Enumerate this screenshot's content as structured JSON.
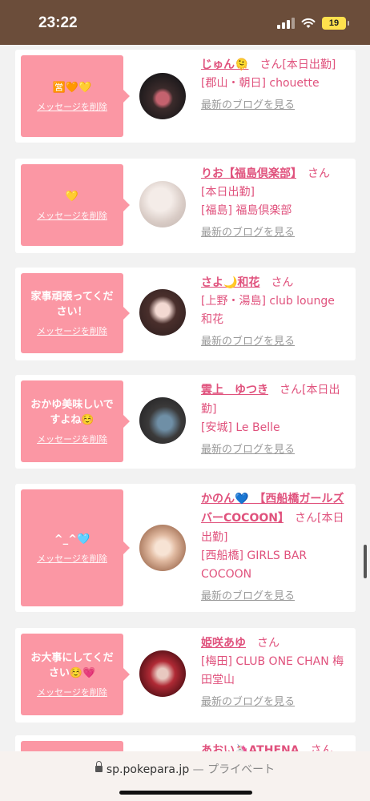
{
  "status_bar": {
    "time": "23:22",
    "battery": "19"
  },
  "delete_label": "メッセージを削除",
  "blog_label": "最新のブログを見る",
  "cards": [
    {
      "message": "🈺🧡💛",
      "name": "じゅん🫠",
      "suffix": "さん[本日出勤]",
      "lines": [
        "[郡山・朝日] chouette"
      ]
    },
    {
      "message": "💛",
      "name": "りお【福島倶楽部】",
      "suffix": "さん",
      "lines": [
        "[本日出勤]",
        "[福島] 福島倶楽部"
      ]
    },
    {
      "message": "家事頑張ってください！",
      "name": "さよ🌙和花",
      "suffix": "さん",
      "lines": [
        "[上野・湯島] club lounge 和花"
      ]
    },
    {
      "message": "おかゆ美味しいですよね☺️",
      "name": "雲上　ゆつき",
      "suffix": "さん[本日出勤]",
      "lines": [
        "[安城] Le Belle"
      ]
    },
    {
      "message": "^_^🩵",
      "name": "かのん💙　【西船橋ガールズバーCOCOON】",
      "suffix": "さん[本日出勤]",
      "lines": [
        "[西船橋] GIRLS BAR COCOON"
      ]
    },
    {
      "message": "お大事にしてください☺️💗",
      "name": "姫咲あゆ",
      "suffix": "さん",
      "lines": [
        "[梅田] CLUB ONE CHAN 梅田堂山"
      ]
    },
    {
      "message": "",
      "name": "あおい🦄ATHENA",
      "suffix": "さん",
      "lines": []
    }
  ],
  "url_bar": {
    "domain": "sp.pokepara.jp",
    "separator": "—",
    "mode": "プライベート"
  }
}
